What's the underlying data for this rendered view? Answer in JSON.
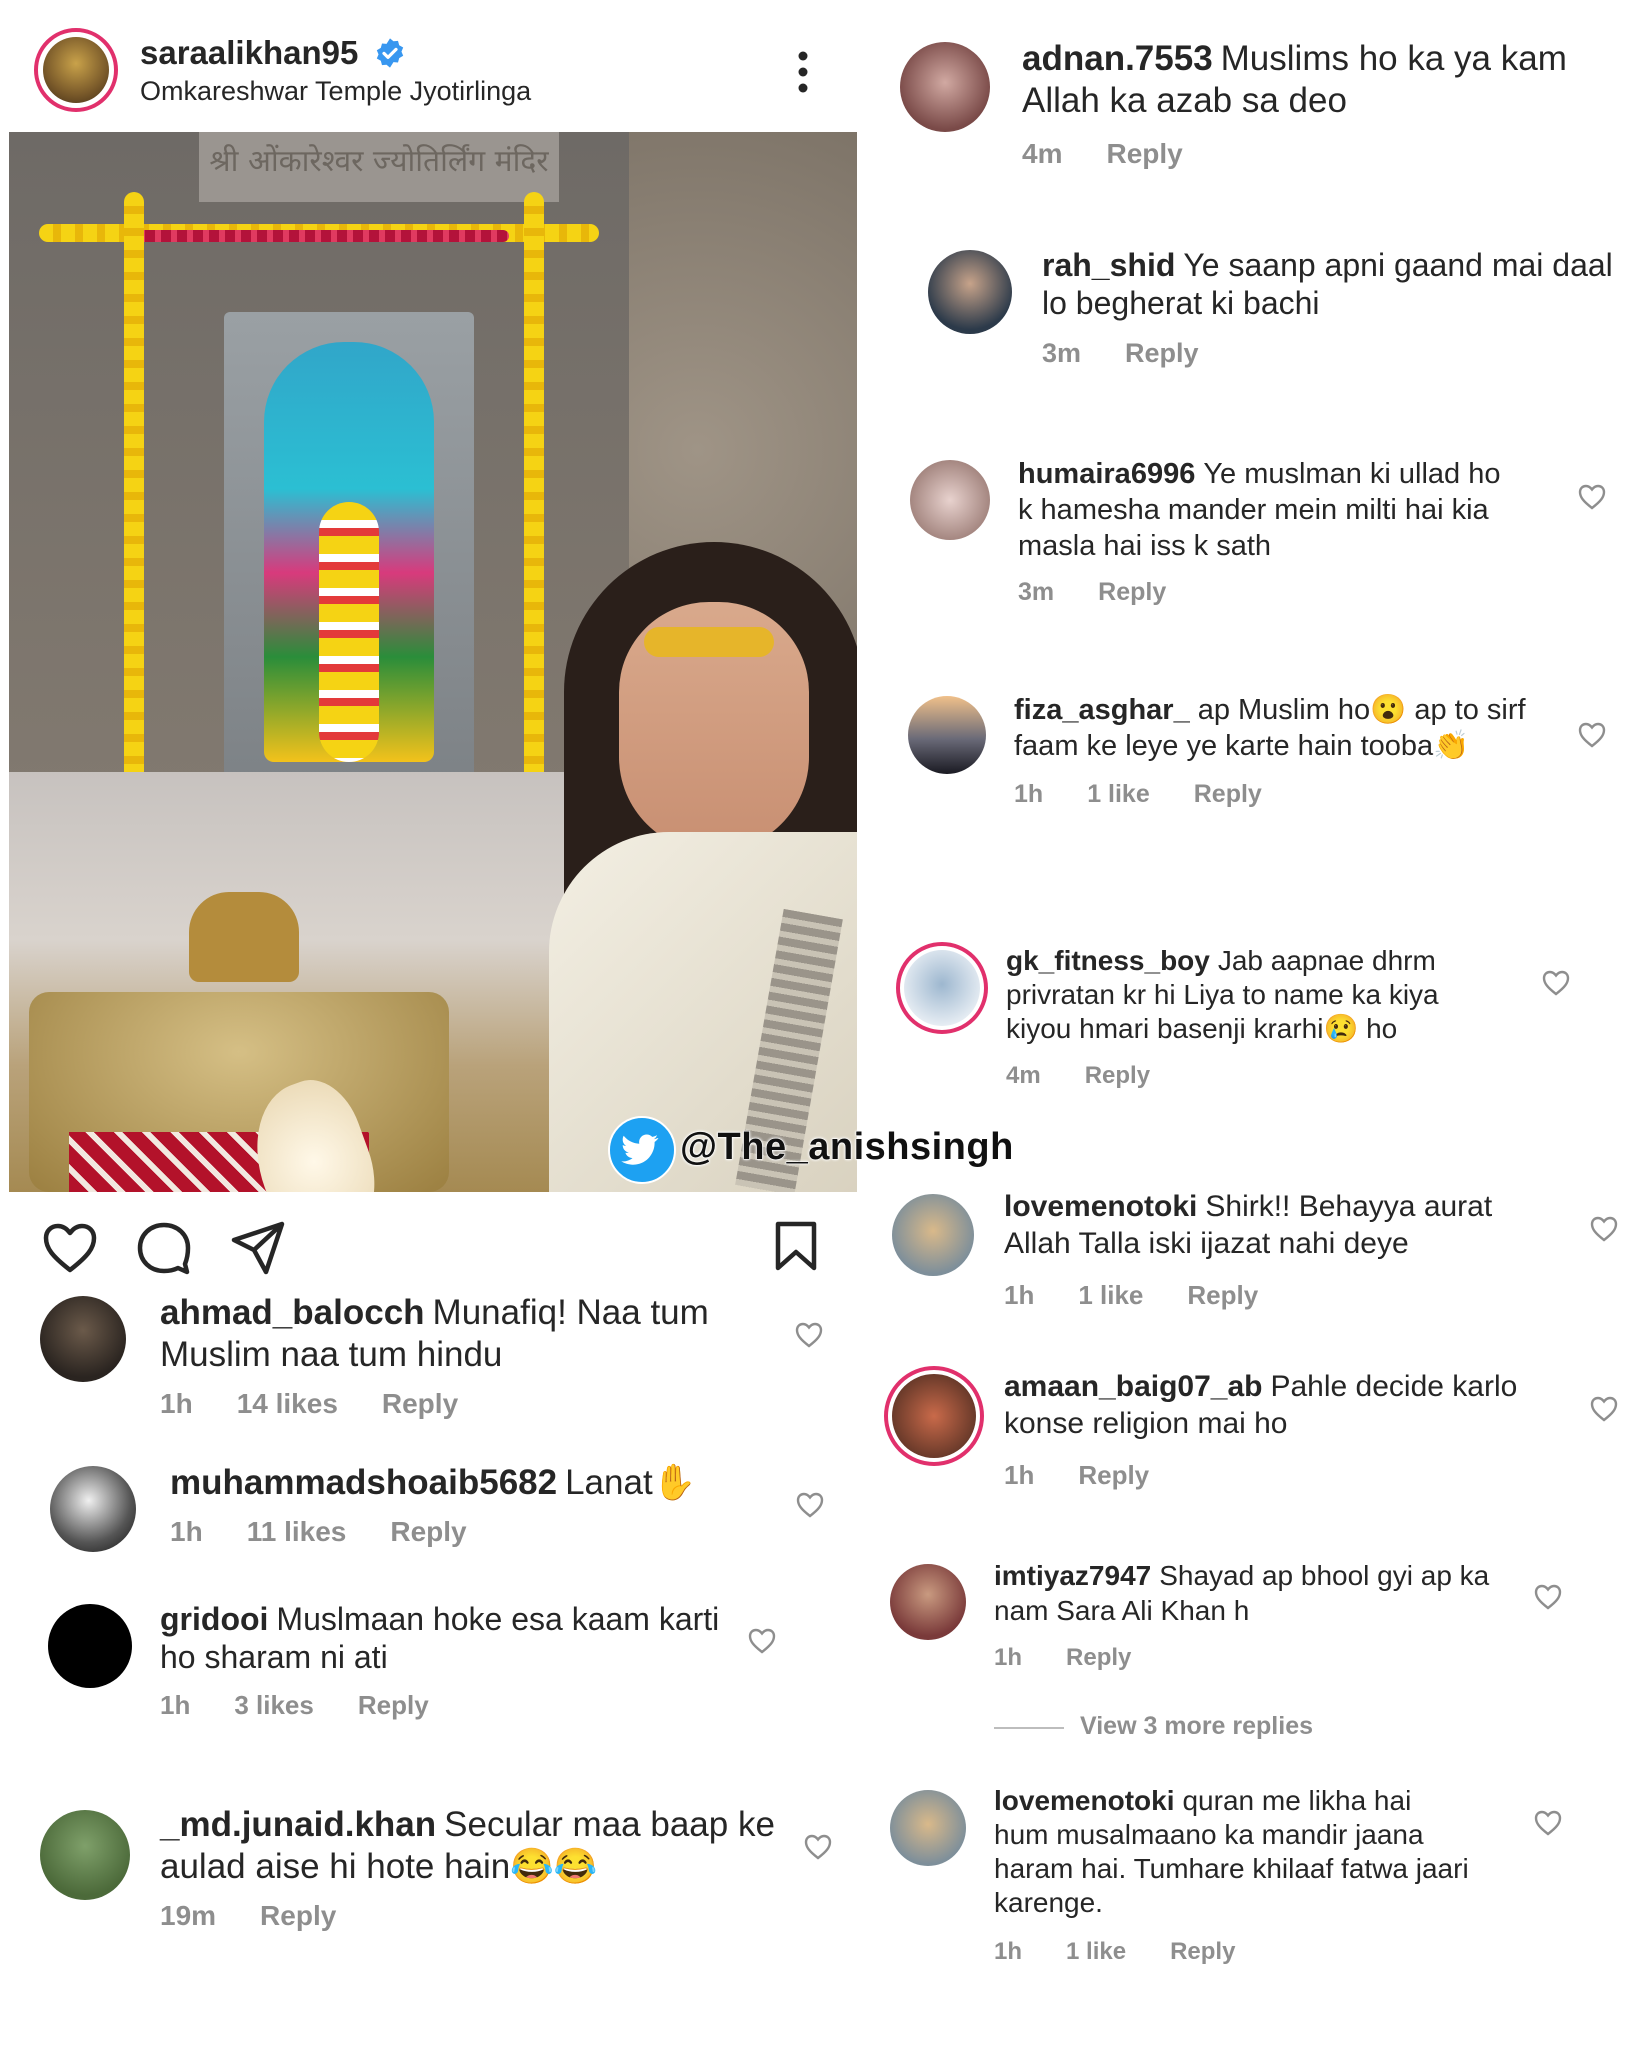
{
  "post": {
    "username": "saraalikhan95",
    "location": "Omkareshwar Temple Jyotirlinga",
    "watermark": "@The_anishsingh",
    "photo_caption_text": "श्री ओंकारेश्वर ज्योतिर्लिंग मंदिर"
  },
  "icons": [
    "verified-badge-icon",
    "more-options-icon",
    "like-icon",
    "comment-icon",
    "share-icon",
    "bookmark-icon",
    "twitter-bird-icon",
    "heart-icon"
  ],
  "colors": {
    "verified": "#3897f0",
    "meta": "#8e8e8e",
    "text": "#262626",
    "twitter": "#1da1f2"
  },
  "left_comments": [
    {
      "user": "ahmad_balocch",
      "text": "Munafiq! Naa tum Muslim naa tum hindu",
      "line1": "Munafiq! Naa tum",
      "line2": "Muslim naa tum hindu",
      "time": "1h",
      "likes": "14 likes",
      "reply": "Reply"
    },
    {
      "user": "muhammadshoaib5682",
      "text": "Lanat✋",
      "time": "1h",
      "likes": "11 likes",
      "reply": "Reply"
    },
    {
      "user": "gridooi",
      "line1": "Muslmaan hoke esa kaam karti",
      "line2": "ho sharam ni ati",
      "time": "1h",
      "likes": "3 likes",
      "reply": "Reply"
    },
    {
      "user": "_md.junaid.khan",
      "line1": "Secular maa baap ke",
      "line2": "aulad aise hi hote hain😂😂",
      "time": "19m",
      "reply": "Reply"
    }
  ],
  "right_comments": [
    {
      "user": "adnan.7553",
      "line1": "Muslims ho ka ya kam",
      "line2": "Allah ka azab sa deo",
      "time": "4m",
      "reply": "Reply"
    },
    {
      "user": "rah_shid",
      "line1": "Ye saanp apni gaand mai daal",
      "line2": "lo begherat ki bachi",
      "time": "3m",
      "reply": "Reply"
    },
    {
      "user": "humaira6996",
      "line1": "Ye muslman ki ullad ho",
      "line2": "k hamesha mander mein milti hai kia",
      "line3": "masla hai iss k sath",
      "time": "3m",
      "reply": "Reply"
    },
    {
      "user": "fiza_asghar_",
      "line1": "ap Muslim ho😮 ap to sirf",
      "line2": "faam ke leye ye karte hain tooba👏",
      "time": "1h",
      "likes": "1 like",
      "reply": "Reply"
    },
    {
      "user": "gk_fitness_boy",
      "line1": "Jab aapnae dhrm",
      "line2": "privratan kr hi Liya to name ka kiya",
      "line3": "kiyou hmari basenji krarhi😢 ho",
      "time": "4m",
      "reply": "Reply"
    },
    {
      "user": "lovemenotoki",
      "line1": "Shirk!! Behayya aurat",
      "line2": "Allah Talla iski ijazat nahi deye",
      "time": "1h",
      "likes": "1 like",
      "reply": "Reply"
    },
    {
      "user": "amaan_baig07_ab",
      "line1": "Pahle decide karlo",
      "line2": "konse religion mai ho",
      "time": "1h",
      "reply": "Reply"
    },
    {
      "user": "imtiyaz7947",
      "line1": "Shayad ap bhool gyi ap ka",
      "line2": "nam Sara Ali Khan h",
      "time": "1h",
      "reply": "Reply"
    },
    {
      "user": "lovemenotoki",
      "line1": "quran me likha hai",
      "line2": "hum musalmaano ka mandir jaana",
      "line3": "haram hai. Tumhare khilaaf fatwa jaari",
      "line4": "karenge.",
      "time": "1h",
      "likes": "1 like",
      "reply": "Reply"
    }
  ],
  "view_more": "View 3 more replies"
}
